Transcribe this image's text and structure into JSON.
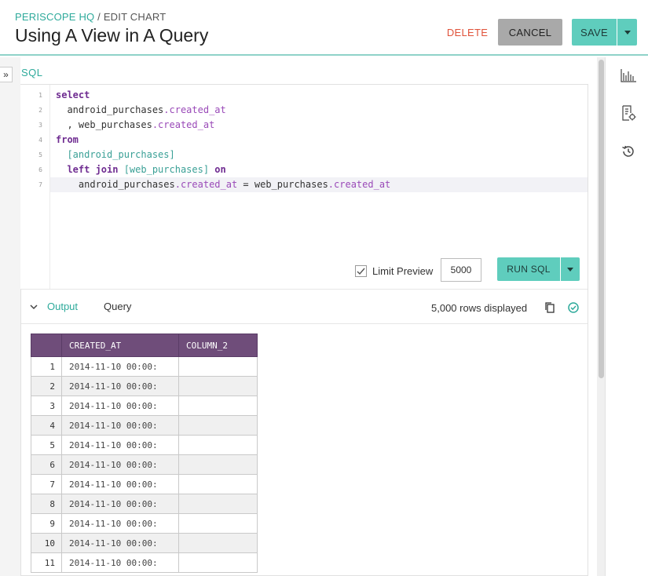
{
  "header": {
    "breadcrumb_link": "PERISCOPE HQ",
    "breadcrumb_sep": " / ",
    "breadcrumb_current": "EDIT CHART",
    "title": "Using A View in A Query",
    "delete_label": "DELETE",
    "cancel_label": "CANCEL",
    "save_label": "SAVE"
  },
  "editor": {
    "section_label": "SQL",
    "expand_glyph": "»",
    "line_numbers": [
      "1",
      "2",
      "3",
      "4",
      "5",
      "6",
      "7"
    ],
    "lines": [
      [
        {
          "t": "select",
          "c": "kw"
        }
      ],
      [
        {
          "t": "  android_purchases",
          "c": ""
        },
        {
          "t": ".created_at",
          "c": "prop"
        }
      ],
      [
        {
          "t": "  , web_purchases",
          "c": ""
        },
        {
          "t": ".created_at",
          "c": "prop"
        }
      ],
      [
        {
          "t": "from",
          "c": "kw"
        }
      ],
      [
        {
          "t": "  [android_purchases]",
          "c": "tbl"
        }
      ],
      [
        {
          "t": "  left join ",
          "c": "kw"
        },
        {
          "t": "[web_purchases]",
          "c": "tbl"
        },
        {
          "t": " on",
          "c": "kw"
        }
      ],
      [
        {
          "t": "    android_purchases",
          "c": ""
        },
        {
          "t": ".created_at",
          "c": "prop"
        },
        {
          "t": " = web_purchases",
          "c": ""
        },
        {
          "t": ".created_at",
          "c": "prop"
        }
      ]
    ],
    "limit_label": "Limit Preview",
    "limit_checked": true,
    "limit_value": "5000",
    "run_label": "RUN SQL"
  },
  "output": {
    "tab_output": "Output",
    "tab_query": "Query",
    "rows_text": "5,000 rows displayed",
    "columns": [
      "CREATED_AT",
      "COLUMN_2"
    ],
    "rows": [
      [
        "1",
        "2014-11-10 00:00:",
        ""
      ],
      [
        "2",
        "2014-11-10 00:00:",
        ""
      ],
      [
        "3",
        "2014-11-10 00:00:",
        ""
      ],
      [
        "4",
        "2014-11-10 00:00:",
        ""
      ],
      [
        "5",
        "2014-11-10 00:00:",
        ""
      ],
      [
        "6",
        "2014-11-10 00:00:",
        ""
      ],
      [
        "7",
        "2014-11-10 00:00:",
        ""
      ],
      [
        "8",
        "2014-11-10 00:00:",
        ""
      ],
      [
        "9",
        "2014-11-10 00:00:",
        ""
      ],
      [
        "10",
        "2014-11-10 00:00:",
        ""
      ],
      [
        "11",
        "2014-11-10 00:00:",
        ""
      ]
    ]
  },
  "sidebar_icons": [
    "bar-chart-icon",
    "chart-settings-icon",
    "history-icon"
  ],
  "colors": {
    "accent": "#2eaa9b",
    "button_teal": "#5fcdbd",
    "delete_red": "#e0523a",
    "table_header": "#6f4d7a",
    "keyword": "#6f2c91"
  }
}
